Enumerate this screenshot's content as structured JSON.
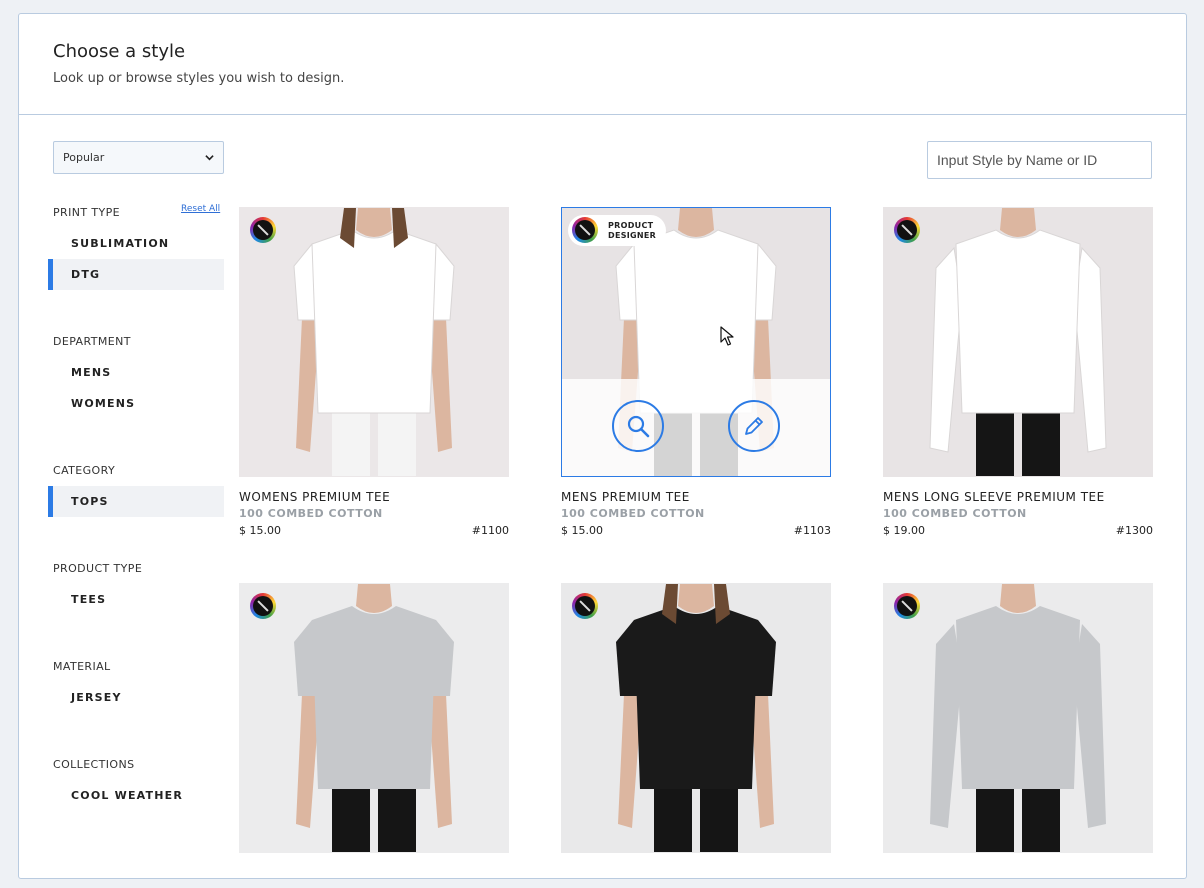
{
  "header": {
    "title": "Choose a style",
    "subtitle": "Look up or browse styles you wish to design."
  },
  "sort": {
    "selected": "Popular"
  },
  "search": {
    "placeholder": "Input Style by Name or ID"
  },
  "filters": {
    "reset_label": "Reset All",
    "sections": [
      {
        "label": "PRINT TYPE",
        "items": [
          {
            "label": "SUBLIMATION",
            "active": false
          },
          {
            "label": "DTG",
            "active": true
          }
        ]
      },
      {
        "label": "DEPARTMENT",
        "items": [
          {
            "label": "MENS",
            "active": false
          },
          {
            "label": "WOMENS",
            "active": false
          }
        ]
      },
      {
        "label": "CATEGORY",
        "items": [
          {
            "label": "TOPS",
            "active": true
          }
        ]
      },
      {
        "label": "PRODUCT TYPE",
        "items": [
          {
            "label": "TEES",
            "active": false
          }
        ]
      },
      {
        "label": "MATERIAL",
        "items": [
          {
            "label": "JERSEY",
            "active": false
          }
        ]
      },
      {
        "label": "COLLECTIONS",
        "items": [
          {
            "label": "COOL WEATHER",
            "active": false
          }
        ]
      }
    ]
  },
  "designer_badge": {
    "line1": "PRODUCT",
    "line2": "DESIGNER"
  },
  "products": [
    {
      "name": "WOMENS PREMIUM TEE",
      "material": "100 COMBED COTTON",
      "price": "$ 15.00",
      "id": "#1100",
      "shirt_color": "#ffffff",
      "sleeve": "short"
    },
    {
      "name": "MENS PREMIUM TEE",
      "material": "100 COMBED COTTON",
      "price": "$ 15.00",
      "id": "#1103",
      "shirt_color": "#ffffff",
      "sleeve": "short"
    },
    {
      "name": "MENS LONG SLEEVE PREMIUM TEE",
      "material": "100 COMBED COTTON",
      "price": "$ 19.00",
      "id": "#1300",
      "shirt_color": "#ffffff",
      "sleeve": "long"
    },
    {
      "shirt_color": "#c6c8cb",
      "sleeve": "short"
    },
    {
      "shirt_color": "#1a1a1a",
      "sleeve": "short"
    },
    {
      "shirt_color": "#c6c8cb",
      "sleeve": "long"
    }
  ],
  "icons": {
    "zoom": "magnifier-icon",
    "edit": "pencil-icon",
    "badge": "product-designer-icon",
    "cursor": "mouse-cursor-icon"
  },
  "colors": {
    "accent": "#2c7be5",
    "border": "#b9cbe0"
  }
}
